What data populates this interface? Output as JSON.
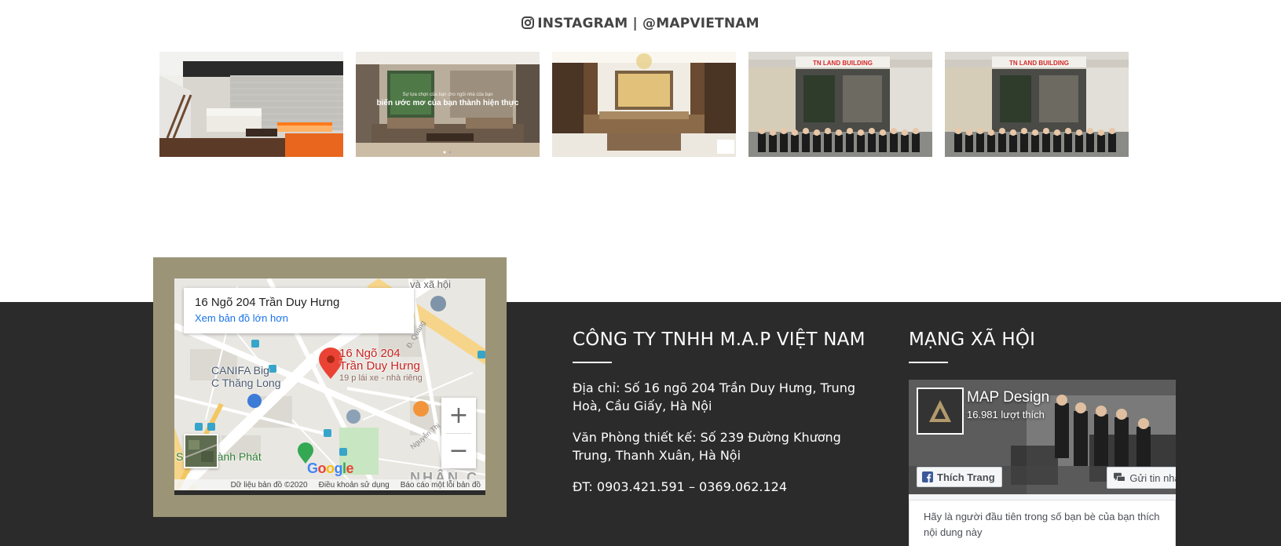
{
  "instagram": {
    "heading": "INSTAGRAM | @MAPVIETNAM",
    "icon": "instagram-icon",
    "posts": [
      {
        "alt": "living room staircase"
      },
      {
        "alt": "luxury living room",
        "overlay_line1": "Sự lựa chọn của bạn cho ngôi nhà của bạn",
        "overlay_line2": "biến ước mơ của bạn thành hiện thực"
      },
      {
        "alt": "classic living room"
      },
      {
        "alt": "team photo 1"
      },
      {
        "alt": "team photo 2"
      }
    ]
  },
  "map": {
    "card_address": "16 Ngõ 204 Trần Duy Hưng",
    "card_link": "Xem bản đồ lớn hơn",
    "pin_label_line1": "16 Ngõ 204",
    "pin_label_line2": "Trần Duy Hưng",
    "pin_sub": "19 p lái xe - nhà riêng",
    "poi_canifa_line1": "CANIFA Big",
    "poi_canifa_line2": "C Thăng Long",
    "poi_thanhphat": "Sang Thành Phát",
    "poi_vaxahoi": "và xã hội",
    "poi_nhanc": "NHÂN C",
    "zoom_in": "+",
    "zoom_out": "−",
    "google": "Google",
    "footer": {
      "data": "Dữ liệu bản đồ ©2020",
      "terms": "Điều khoản sử dụng",
      "report": "Báo cáo một lỗi bản đồ"
    }
  },
  "company": {
    "title": "CÔNG TY TNHH M.A.P VIỆT NAM",
    "address": "Địa chỉ: Số 16 ngõ 204 Trần Duy Hưng, Trung Hoà, Cầu Giấy, Hà Nội",
    "office": "Văn Phòng thiết kế: Số 239 Đường Khương Trung, Thanh Xuân, Hà Nội",
    "phone": "ĐT: 0903.421.591 – 0369.062.124"
  },
  "social": {
    "title": "MẠNG XÃ HỘI",
    "fb": {
      "page_name": "MAP Design",
      "likes": "16.981 lượt thích",
      "like_button": "Thích Trang",
      "message_button": "Gửi tin nhắn",
      "friends_text": "Hãy là người đầu tiên trong số bạn bè của bạn thích nội dung này"
    }
  },
  "colors": {
    "footer_bg": "#2b2b2b",
    "map_frame": "#9b9477",
    "link_blue": "#1a73e8",
    "pin_red": "#c5221f"
  }
}
